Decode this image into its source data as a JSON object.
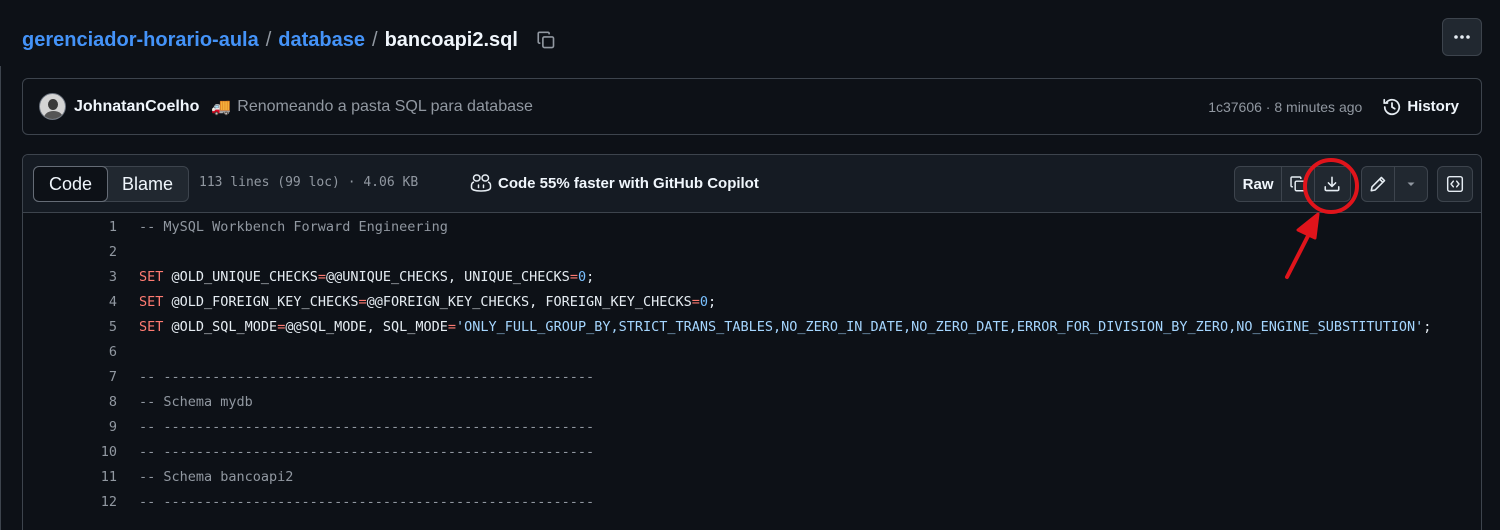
{
  "breadcrumb": {
    "repo": "gerenciador-horario-aula",
    "folder": "database",
    "file": "bancoapi2.sql",
    "separator": "/"
  },
  "commit": {
    "author": "JohnatanCoelho",
    "emoji": "🚚",
    "message": "Renomeando a pasta SQL para database",
    "meta": "1c37606 · 8 minutes ago",
    "history_label": "History"
  },
  "file_header": {
    "tabs": [
      {
        "label": "Code",
        "active": true
      },
      {
        "label": "Blame",
        "active": false
      }
    ],
    "stats": "113 lines (99 loc) · 4.06 KB",
    "copilot_label": "Code 55% faster with GitHub Copilot",
    "raw_label": "Raw"
  },
  "code_lines": [
    {
      "n": "1",
      "text": "-- MySQL Workbench Forward Engineering"
    },
    {
      "n": "2",
      "text": ""
    },
    {
      "n": "3",
      "text": "SET @OLD_UNIQUE_CHECKS=@@UNIQUE_CHECKS, UNIQUE_CHECKS=0;"
    },
    {
      "n": "4",
      "text": "SET @OLD_FOREIGN_KEY_CHECKS=@@FOREIGN_KEY_CHECKS, FOREIGN_KEY_CHECKS=0;"
    },
    {
      "n": "5",
      "text": "SET @OLD_SQL_MODE=@@SQL_MODE, SQL_MODE='ONLY_FULL_GROUP_BY,STRICT_TRANS_TABLES,NO_ZERO_IN_DATE,NO_ZERO_DATE,ERROR_FOR_DIVISION_BY_ZERO,NO_ENGINE_SUBSTITUTION';"
    },
    {
      "n": "6",
      "text": ""
    },
    {
      "n": "7",
      "text": "-- -----------------------------------------------------"
    },
    {
      "n": "8",
      "text": "-- Schema mydb"
    },
    {
      "n": "9",
      "text": "-- -----------------------------------------------------"
    },
    {
      "n": "10",
      "text": "-- -----------------------------------------------------"
    },
    {
      "n": "11",
      "text": "-- Schema bancoapi2"
    },
    {
      "n": "12",
      "text": "-- -----------------------------------------------------"
    }
  ],
  "icons": {
    "copy_path": "copy-icon",
    "more": "kebab-horizontal-icon",
    "history": "history-icon",
    "copilot": "copilot-icon",
    "copy_raw": "copy-icon",
    "download": "download-icon",
    "edit": "pencil-icon",
    "edit_menu": "triangle-down-icon",
    "symbols": "code-square-icon"
  },
  "colors": {
    "background": "#0d1117",
    "link": "#4493f8",
    "keyword": "#ff7b72",
    "string": "#a5d6ff",
    "annotation": "#e0141b"
  }
}
